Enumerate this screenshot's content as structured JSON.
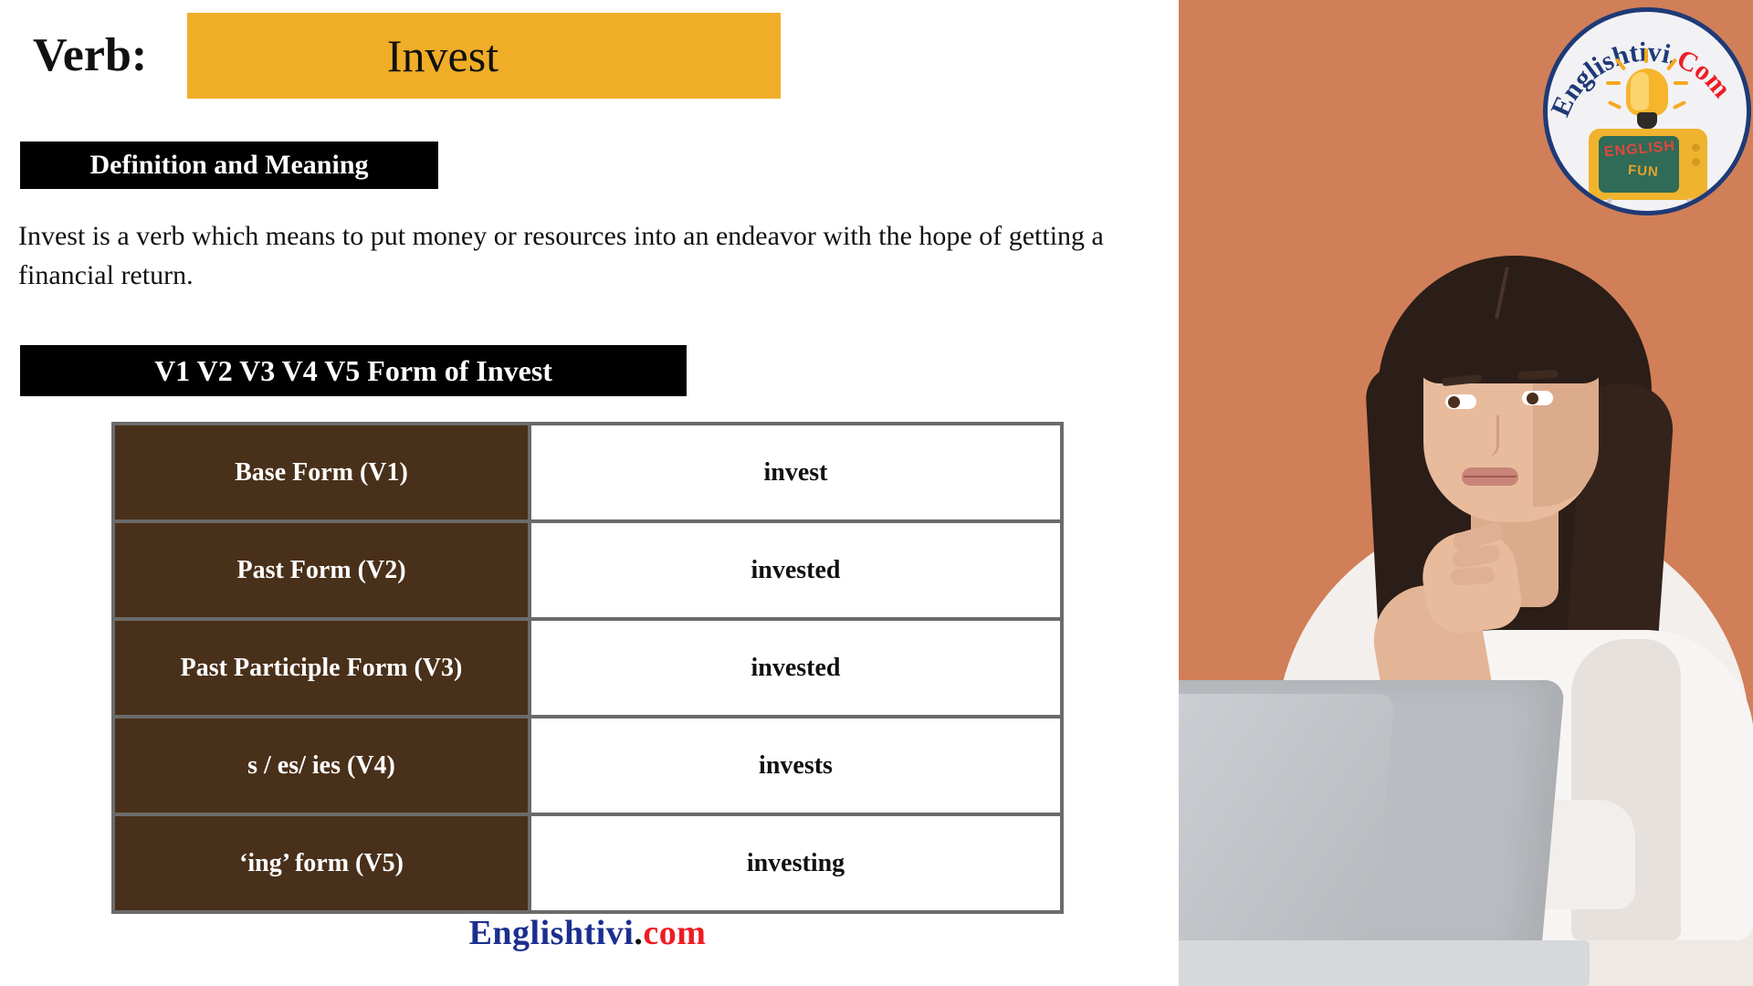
{
  "header": {
    "verb_label": "Verb:",
    "verb_word": "Invest"
  },
  "definition": {
    "section_label": "Definition and Meaning",
    "text": "Invest is a verb which means to put money or resources into an endeavor with the hope of getting a financial return."
  },
  "forms": {
    "section_label": "V1 V2 V3 V4 V5 Form of Invest",
    "rows": [
      {
        "label": "Base Form (V1)",
        "value": "invest"
      },
      {
        "label": "Past Form (V2)",
        "value": "invested"
      },
      {
        "label": "Past Participle Form (V3)",
        "value": "invested"
      },
      {
        "label": "s / es/ ies (V4)",
        "value": "invests"
      },
      {
        "label": "‘ing’ form (V5)",
        "value": "investing"
      }
    ]
  },
  "footer": {
    "name": "Englishtivi",
    "dot": ".",
    "tld": "com"
  },
  "logo": {
    "arc_text_primary": "Englishtivi.",
    "arc_text_secondary": "Com",
    "tv_word_1": "ENGLISH",
    "tv_word_2": "FUN"
  },
  "colors": {
    "accent_yellow": "#f0ad27",
    "table_brown": "#49301a",
    "table_border": "#6b6b6b",
    "panel_orange": "#d07f59",
    "footer_navy": "#1c2f8f",
    "footer_red": "#ee1d24",
    "logo_ring_navy": "#1f3a76"
  }
}
